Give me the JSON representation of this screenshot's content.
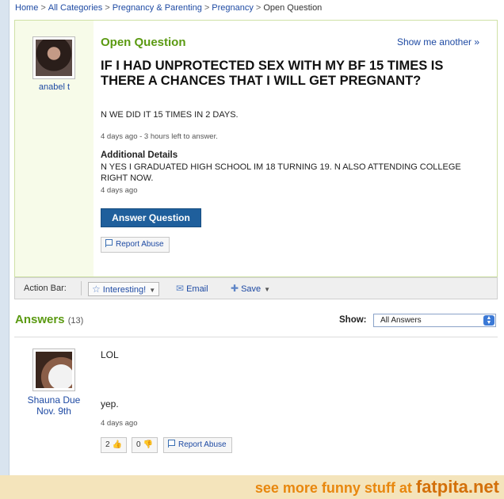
{
  "breadcrumb": {
    "items": [
      "Home",
      "All Categories",
      "Pregnancy & Parenting",
      "Pregnancy"
    ],
    "current": "Open Question",
    "separator": ">"
  },
  "question": {
    "asker": "anabel t",
    "status_label": "Open Question",
    "show_another": "Show me another »",
    "title": "IF I HAD UNPROTECTED SEX WITH MY BF 15 TIMES IS THERE A CHANCES THAT I WILL GET PREGNANT?",
    "body": "N WE DID IT 15 TIMES IN 2 DAYS.",
    "meta": "4 days ago - 3 hours left to answer.",
    "additional_details_heading": "Additional Details",
    "additional_details_text": "N YES I GRADUATED HIGH SCHOOL IM 18 TURNING 19. N ALSO ATTENDING COLLEGE RIGHT NOW.",
    "additional_details_time": "4 days ago",
    "answer_button": "Answer Question",
    "report_abuse": "Report Abuse"
  },
  "action_bar": {
    "label": "Action Bar:",
    "interesting": "Interesting!",
    "email": "Email",
    "save": "Save"
  },
  "answers": {
    "heading": "Answers",
    "count": "(13)",
    "show_label": "Show:",
    "show_selected": "All Answers",
    "items": [
      {
        "name": "Shauna Due",
        "date": "Nov. 9th",
        "text1": "LOL",
        "text2": "yep.",
        "time": "4 days ago",
        "thumbs_up": "2",
        "thumbs_down": "0",
        "report": "Report Abuse"
      }
    ]
  },
  "footer": {
    "prefix": "see more funny stuff at",
    "brand": "fatpita.net"
  },
  "colors": {
    "accent_green": "#5b9a12",
    "link_blue": "#1e4aa3",
    "button_blue": "#1f5f9c",
    "footer_orange": "#e8870e",
    "footer_band": "#f4e4bb"
  }
}
